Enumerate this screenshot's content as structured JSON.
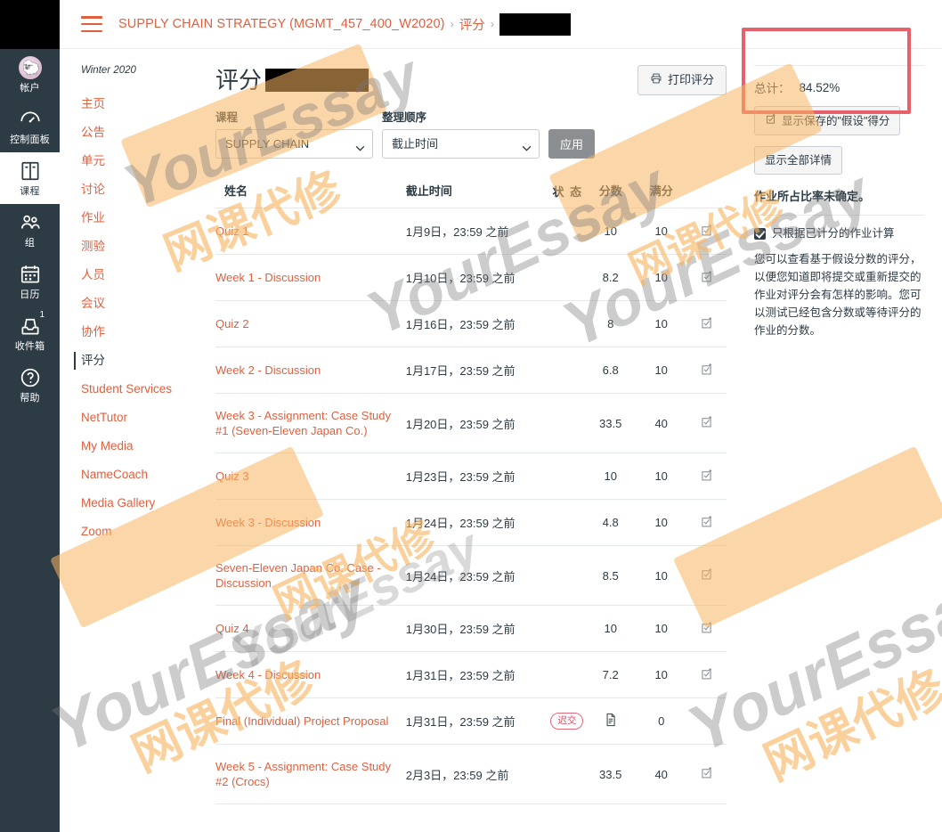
{
  "global_nav": {
    "items": [
      {
        "label": "帐户",
        "icon": "avatar-icon",
        "active": false,
        "badge": ""
      },
      {
        "label": "控制面板",
        "icon": "dashboard-icon",
        "active": false,
        "badge": ""
      },
      {
        "label": "课程",
        "icon": "courses-icon",
        "active": true,
        "badge": ""
      },
      {
        "label": "组",
        "icon": "groups-icon",
        "active": false,
        "badge": ""
      },
      {
        "label": "日历",
        "icon": "calendar-icon",
        "active": false,
        "badge": ""
      },
      {
        "label": "收件箱",
        "icon": "inbox-icon",
        "active": false,
        "badge": "1"
      },
      {
        "label": "帮助",
        "icon": "help-icon",
        "active": false,
        "badge": ""
      }
    ]
  },
  "course_nav": {
    "term": "Winter 2020",
    "items": [
      {
        "label": "主页",
        "active": false
      },
      {
        "label": "公告",
        "active": false
      },
      {
        "label": "单元",
        "active": false
      },
      {
        "label": "讨论",
        "active": false
      },
      {
        "label": "作业",
        "active": false
      },
      {
        "label": "测验",
        "active": false
      },
      {
        "label": "人员",
        "active": false
      },
      {
        "label": "会议",
        "active": false
      },
      {
        "label": "协作",
        "active": false
      },
      {
        "label": "评分",
        "active": true
      },
      {
        "label": "Student Services",
        "active": false
      },
      {
        "label": "NetTutor",
        "active": false
      },
      {
        "label": "My Media",
        "active": false
      },
      {
        "label": "NameCoach",
        "active": false
      },
      {
        "label": "Media Gallery",
        "active": false
      },
      {
        "label": "Zoom",
        "active": false
      }
    ]
  },
  "topbar": {
    "menu_icon": "hamburger-icon",
    "crumb_course": "SUPPLY CHAIN STRATEGY (MGMT_457_400_W2020)",
    "crumb_sep": "›",
    "crumb_grades": "评分",
    "crumb_redacted": ""
  },
  "main": {
    "page_title": "评分",
    "print_button": "打印评分",
    "print_icon": "printer-icon",
    "filters": {
      "course_label": "课程",
      "course_value": "SUPPLY CHAIN",
      "order_label": "整理顺序",
      "order_value": "截止时间",
      "apply_label": "应用",
      "chevron_icon": "chevron-down-icon"
    },
    "table": {
      "headers": {
        "name": "姓名",
        "due": "截止时间",
        "status_line1": "状",
        "status_line2": "态",
        "score": "分数",
        "out_of": "满分"
      },
      "rows": [
        {
          "name": "Quiz 1",
          "due": "1月9日，23:59 之前",
          "status": "",
          "score": "10",
          "out_of": "10",
          "detail_icon": "rubric-icon"
        },
        {
          "name": "Week 1 - Discussion",
          "due": "1月10日，23:59 之前",
          "status": "",
          "score": "8.2",
          "out_of": "10",
          "detail_icon": "rubric-icon"
        },
        {
          "name": "Quiz 2",
          "due": "1月16日，23:59 之前",
          "status": "",
          "score": "8",
          "out_of": "10",
          "detail_icon": "rubric-icon"
        },
        {
          "name": "Week 2 - Discussion",
          "due": "1月17日，23:59 之前",
          "status": "",
          "score": "6.8",
          "out_of": "10",
          "detail_icon": "rubric-icon"
        },
        {
          "name": "Week 3 - Assignment: Case Study #1 (Seven-Eleven Japan Co.)",
          "due": "1月20日，23:59 之前",
          "status": "",
          "score": "33.5",
          "out_of": "40",
          "detail_icon": "rubric-icon"
        },
        {
          "name": "Quiz 3",
          "due": "1月23日，23:59 之前",
          "status": "",
          "score": "10",
          "out_of": "10",
          "detail_icon": "rubric-icon"
        },
        {
          "name": "Week 3 - Discussion",
          "due": "1月24日，23:59 之前",
          "status": "",
          "score": "4.8",
          "out_of": "10",
          "detail_icon": "rubric-icon"
        },
        {
          "name": "Seven-Eleven Japan Co. Case - Discussion",
          "due": "1月24日，23:59 之前",
          "status": "",
          "score": "8.5",
          "out_of": "10",
          "detail_icon": "rubric-icon"
        },
        {
          "name": "Quiz 4",
          "due": "1月30日，23:59 之前",
          "status": "",
          "score": "10",
          "out_of": "10",
          "detail_icon": "rubric-icon"
        },
        {
          "name": "Week 4 - Discussion",
          "due": "1月31日，23:59 之前",
          "status": "",
          "score": "7.2",
          "out_of": "10",
          "detail_icon": "rubric-icon"
        },
        {
          "name": "Final (Individual) Project Proposal",
          "due": "1月31日，23:59 之前",
          "status": "迟交",
          "score": "",
          "out_of": "0",
          "detail_icon": "document-icon"
        },
        {
          "name": "Week 5 - Assignment: Case Study #2 (Crocs)",
          "due": "2月3日，23:59 之前",
          "status": "",
          "score": "33.5",
          "out_of": "40",
          "detail_icon": "rubric-icon"
        }
      ]
    }
  },
  "right_rail": {
    "total_label": "总计：",
    "total_value": "84.52%",
    "show_saved_whatif_label": "显示保存的\"假设\"得分",
    "show_saved_whatif_icon": "rubric-icon",
    "show_all_details_label": "显示全部详情",
    "weight_note": "作业所占比率未确定。",
    "graded_only_label": "只根据已计分的作业计算",
    "graded_only_checked": true,
    "help_text": "您可以查看基于假设分数的评分，以便您知道即将提交或重新提交的作业对评分会有怎样的影响。您可以测试已经包含分数或等待评分的作业的分数。"
  },
  "annotations": {
    "highlight_color": "#e8606a"
  },
  "watermarks": {
    "brand_latin": "YourEssay",
    "brand_cn": "网课代修"
  }
}
